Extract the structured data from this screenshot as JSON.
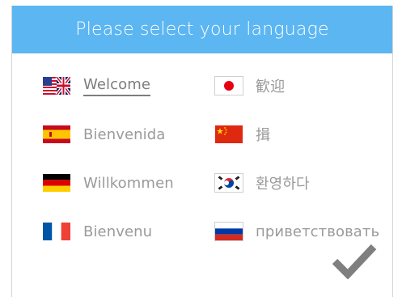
{
  "header": {
    "title": "Please select your language"
  },
  "languages": [
    {
      "label": "Welcome",
      "flag": "uk-us-flag-icon",
      "selected": true
    },
    {
      "label": "Bienvenida",
      "flag": "spain-flag-icon"
    },
    {
      "label": "Willkommen",
      "flag": "germany-flag-icon"
    },
    {
      "label": "Bienvenu",
      "flag": "france-flag-icon"
    },
    {
      "label": "歓迎",
      "flag": "japan-flag-icon"
    },
    {
      "label": "揖",
      "flag": "china-flag-icon"
    },
    {
      "label": "환영하다",
      "flag": "korea-flag-icon"
    },
    {
      "label": "приветствовать",
      "flag": "russia-flag-icon"
    }
  ],
  "confirm": {
    "icon": "checkmark-icon"
  },
  "colors": {
    "header_bg": "#5cb6f2",
    "label_text": "#9a9a9a",
    "check": "#7f7f7f"
  }
}
